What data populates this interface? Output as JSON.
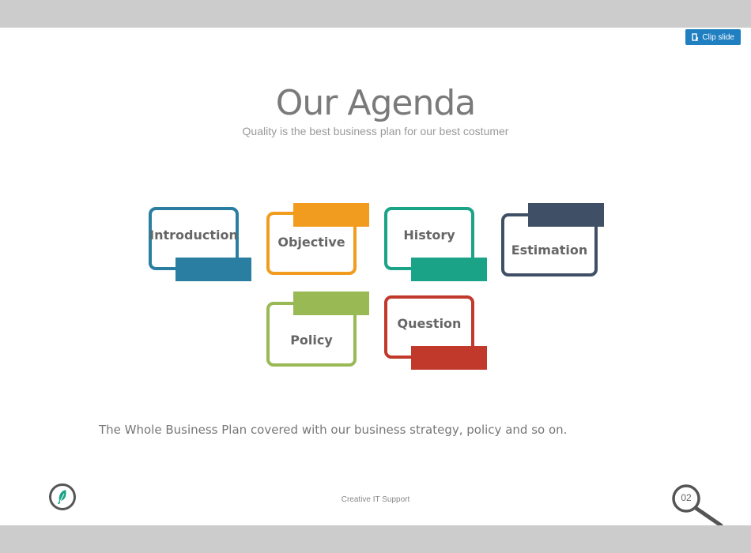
{
  "toolbar": {
    "clip_label": "Clip slide"
  },
  "slide": {
    "title": "Our Agenda",
    "subtitle": "Quality is the best business plan for our best costumer",
    "agenda": [
      {
        "label": "Introduction",
        "color": "#2a7ea1"
      },
      {
        "label": "Objective",
        "color": "#f29c1f"
      },
      {
        "label": "History",
        "color": "#1aa387"
      },
      {
        "label": "Estimation",
        "color": "#3f4f66"
      },
      {
        "label": "Policy",
        "color": "#99b954"
      },
      {
        "label": "Question",
        "color": "#c0392b"
      }
    ],
    "body": "The Whole Business Plan covered with our business strategy, policy and so on.",
    "footer": "Creative IT Support",
    "page_number": "02",
    "logo_icon": "feather-icon",
    "page_icon": "magnifier-icon"
  }
}
